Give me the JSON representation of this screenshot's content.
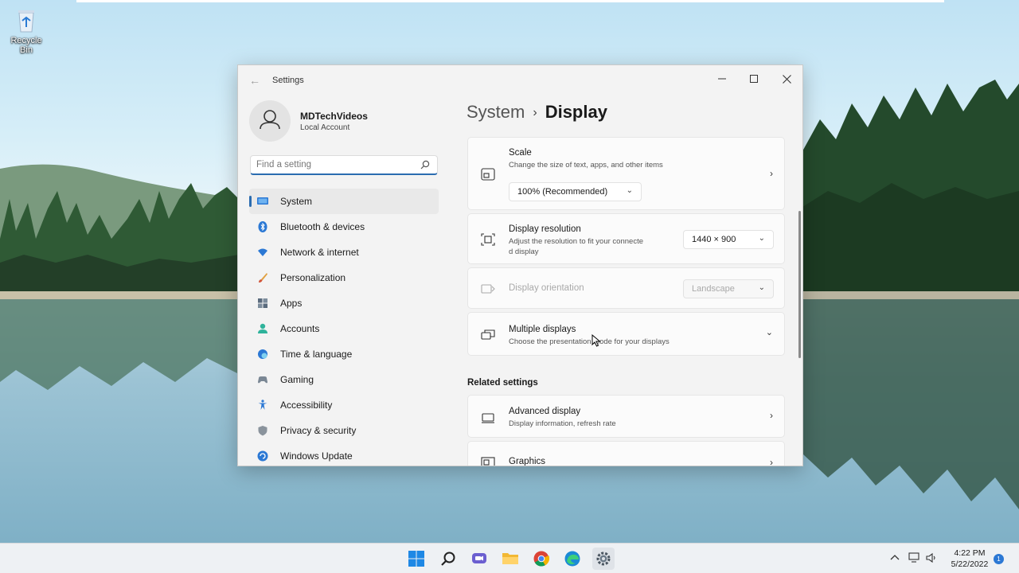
{
  "desktop": {
    "recycle_bin_label": "Recycle Bin"
  },
  "window": {
    "title": "Settings",
    "profile": {
      "name": "MDTechVideos",
      "account_type": "Local Account"
    },
    "search": {
      "placeholder": "Find a setting"
    },
    "nav": [
      {
        "label": "System",
        "icon": "system-icon",
        "active": true
      },
      {
        "label": "Bluetooth & devices",
        "icon": "bluetooth-icon"
      },
      {
        "label": "Network & internet",
        "icon": "wifi-icon"
      },
      {
        "label": "Personalization",
        "icon": "brush-icon"
      },
      {
        "label": "Apps",
        "icon": "apps-icon"
      },
      {
        "label": "Accounts",
        "icon": "person-icon"
      },
      {
        "label": "Time & language",
        "icon": "globe-clock-icon"
      },
      {
        "label": "Gaming",
        "icon": "controller-icon"
      },
      {
        "label": "Accessibility",
        "icon": "accessibility-icon"
      },
      {
        "label": "Privacy & security",
        "icon": "shield-icon"
      },
      {
        "label": "Windows Update",
        "icon": "update-icon"
      }
    ],
    "breadcrumb": {
      "parent": "System",
      "separator": "›",
      "current": "Display"
    },
    "cards": {
      "scale": {
        "title": "Scale",
        "subtitle": "Change the size of text, apps, and other items",
        "value": "100% (Recommended)"
      },
      "resolution": {
        "title": "Display resolution",
        "subtitle_line1": "Adjust the resolution to fit your connecte",
        "subtitle_line2": "d display",
        "value": "1440 × 900"
      },
      "orientation": {
        "title": "Display orientation",
        "value": "Landscape",
        "enabled": false
      },
      "multiple": {
        "title": "Multiple displays",
        "subtitle": "Choose the presentation mode for your displays"
      }
    },
    "related_heading": "Related settings",
    "related": {
      "advanced": {
        "title": "Advanced display",
        "subtitle": "Display information, refresh rate"
      },
      "graphics": {
        "title": "Graphics"
      }
    }
  },
  "taskbar": {
    "apps": [
      "start-icon",
      "search-icon",
      "chat-icon",
      "file-explorer-icon",
      "chrome-icon",
      "edge-icon",
      "settings-icon"
    ],
    "clock": {
      "time": "4:22 PM",
      "date": "5/22/2022"
    },
    "notification_count": "1"
  },
  "colors": {
    "accent": "#2b6cb0",
    "window_bg": "#f3f3f3",
    "card_bg": "#fbfbfb",
    "taskbar_bg": "#eef1f4"
  }
}
